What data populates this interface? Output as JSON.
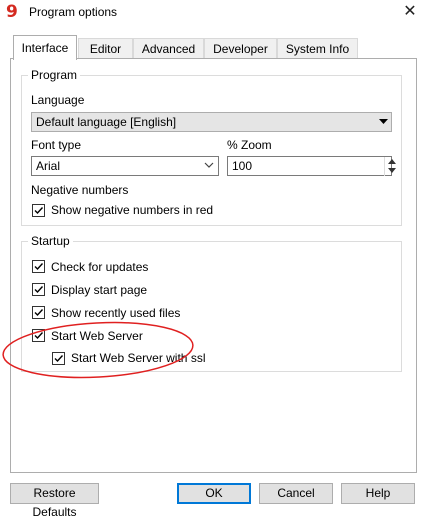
{
  "window": {
    "app_icon_glyph": "9",
    "title": "Program options",
    "close_glyph": "✕"
  },
  "tabs": [
    {
      "label": "Interface",
      "active": true
    },
    {
      "label": "Editor",
      "active": false
    },
    {
      "label": "Advanced",
      "active": false
    },
    {
      "label": "Developer",
      "active": false
    },
    {
      "label": "System Info",
      "active": false
    }
  ],
  "program": {
    "group_title": "Program",
    "language_label": "Language",
    "language_value": "Default language [English]",
    "font_type_label": "Font type",
    "font_type_value": "Arial",
    "zoom_label": "% Zoom",
    "zoom_value": "100",
    "negative_numbers_label": "Negative numbers",
    "show_negative_red": {
      "label": "Show negative numbers in red",
      "checked": true
    }
  },
  "startup": {
    "group_title": "Startup",
    "items": [
      {
        "label": "Check for updates",
        "checked": true
      },
      {
        "label": "Display start page",
        "checked": true
      },
      {
        "label": "Show recently used files",
        "checked": true
      },
      {
        "label": "Start Web Server",
        "checked": true
      },
      {
        "label": "Start Web Server with ssl",
        "checked": true
      }
    ]
  },
  "annotation": {
    "shape": "ellipse",
    "color": "#e02020"
  },
  "buttons": {
    "restore_defaults": "Restore Defaults",
    "ok": "OK",
    "cancel": "Cancel",
    "help": "Help"
  }
}
